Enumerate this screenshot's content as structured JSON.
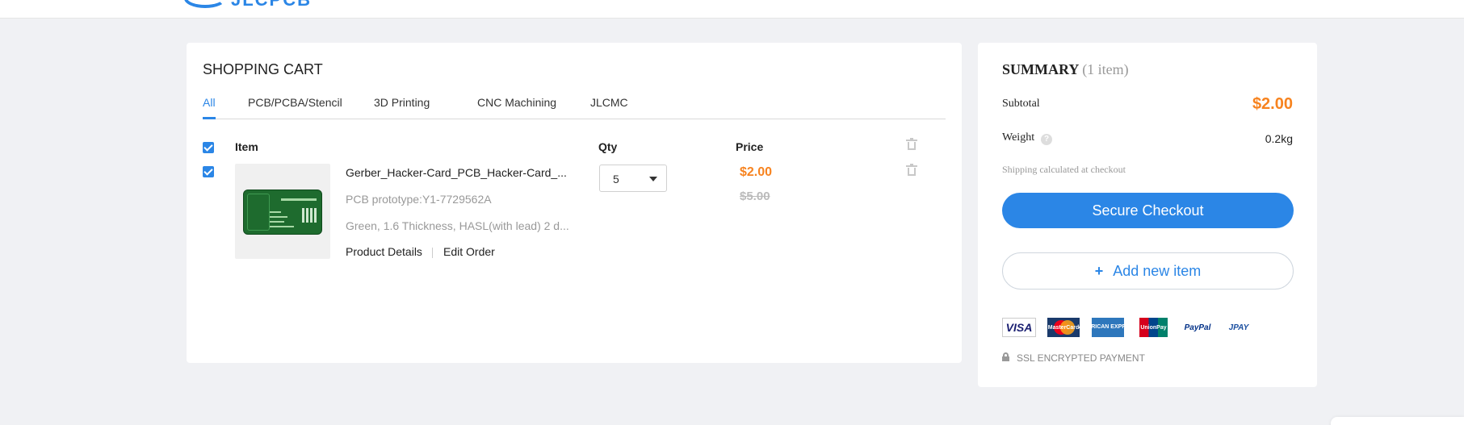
{
  "header": {
    "logo_text": "JLCPCB",
    "colors": {
      "accent": "#2b86e6",
      "price": "#f7831f",
      "background": "#f0f1f4"
    }
  },
  "cart": {
    "title": "SHOPPING CART",
    "tabs": [
      {
        "label": "All",
        "active": true
      },
      {
        "label": "PCB/PCBA/Stencil",
        "active": false
      },
      {
        "label": "3D Printing",
        "active": false
      },
      {
        "label": "CNC Machining",
        "active": false
      },
      {
        "label": "JLCMC",
        "active": false
      }
    ],
    "columns": {
      "item": "Item",
      "qty": "Qty",
      "price": "Price"
    },
    "items": [
      {
        "name": "Gerber_Hacker-Card_PCB_Hacker-Card_...",
        "prototype": "PCB prototype:Y1-7729562A",
        "specs": "Green, 1.6 Thickness, HASL(with lead) 2 d...",
        "details_link": "Product Details",
        "edit_link": "Edit Order",
        "qty": "5",
        "price": "$2.00",
        "original_price": "$5.00",
        "checked": true
      }
    ]
  },
  "summary": {
    "title": "SUMMARY",
    "count": "(1 item)",
    "subtotal_label": "Subtotal",
    "subtotal_value": "$2.00",
    "weight_label": "Weight",
    "weight_value": "0.2kg",
    "help_icon": "?",
    "shipping_note": "Shipping calculated at checkout",
    "checkout_label": "Secure Checkout",
    "add_label": "Add new item",
    "add_icon": "+",
    "payments": {
      "visa": "VISA",
      "mastercard": "MasterCard",
      "amex": "AMERICAN EXPRESS",
      "unionpay": "UnionPay",
      "paypal": "PayPal",
      "jpay": "JPAY"
    },
    "ssl_text": "SSL ENCRYPTED PAYMENT"
  }
}
